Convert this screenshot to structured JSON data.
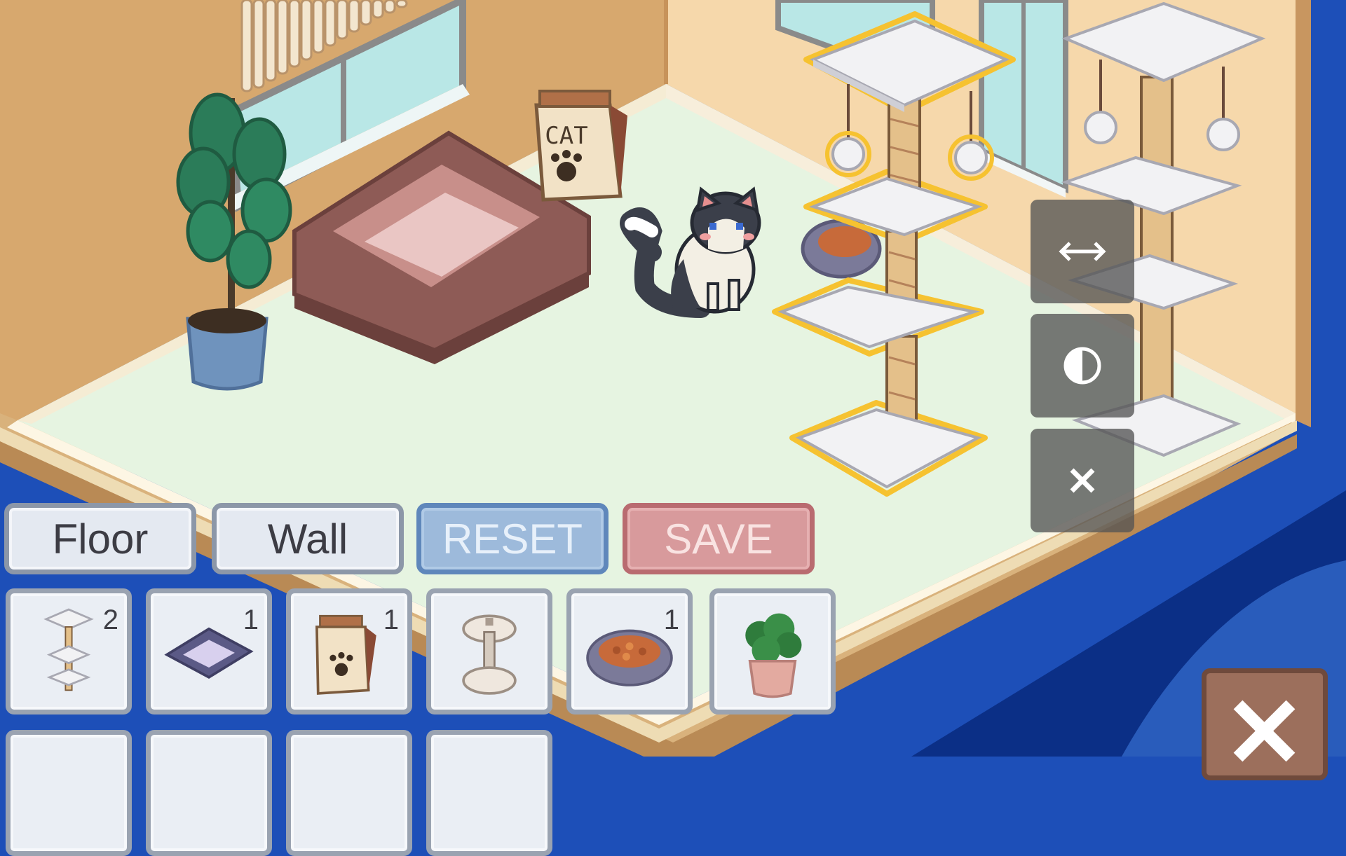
{
  "toolbar": {
    "floor_label": "Floor",
    "wall_label": "Wall",
    "reset_label": "RESET",
    "save_label": "SAVE"
  },
  "inventory": [
    {
      "icon": "cat-tree-icon",
      "count": "2"
    },
    {
      "icon": "cat-bed-icon",
      "count": "1"
    },
    {
      "icon": "cat-food-bag-icon",
      "count": "1"
    },
    {
      "icon": "scratch-post-icon",
      "count": ""
    },
    {
      "icon": "food-bowl-icon",
      "count": "1"
    },
    {
      "icon": "potted-plant-icon",
      "count": ""
    }
  ],
  "room": {
    "food_bag_text": "CAT"
  },
  "object_tools": {
    "flip_icon": "flip-horizontal-icon",
    "recolor_icon": "contrast-icon",
    "remove_icon": "close-icon"
  },
  "exit_icon": "close-icon",
  "colors": {
    "floor": "#e6f4e1",
    "wall": "#d7a86e",
    "selection": "#f6c230",
    "reset": "#9dbadb",
    "save": "#d89a9c"
  }
}
